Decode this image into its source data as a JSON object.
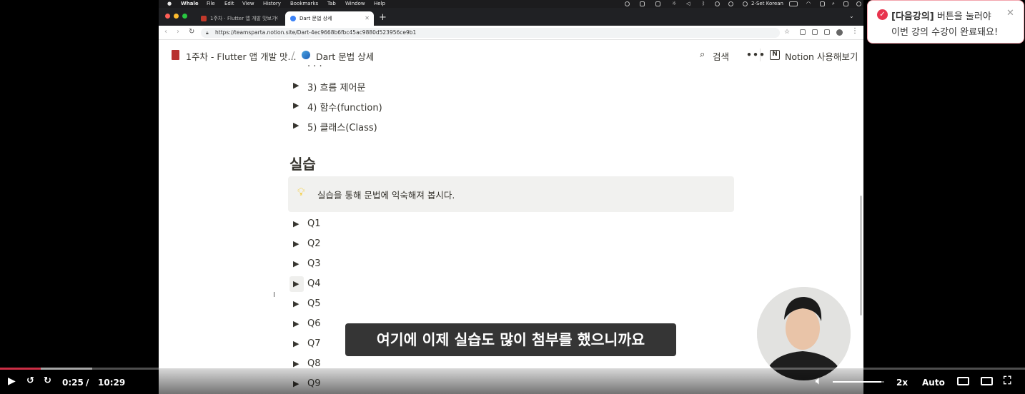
{
  "menubar": {
    "app": "Whale",
    "items": [
      "File",
      "Edit",
      "View",
      "History",
      "Bookmarks",
      "Tab",
      "Window",
      "Help"
    ],
    "input_source": "2-Set Korean"
  },
  "browser": {
    "tabs": [
      {
        "label": "1주차 · Flutter 앱 개발 맛보기",
        "active": false
      },
      {
        "label": "Dart 문법 상세",
        "active": true
      }
    ],
    "url": "https://teamsparta.notion.site/Dart-4ec9668b6fbc45ac9880d523956ce9b1"
  },
  "notion": {
    "breadcrumb": [
      "1주차 - Flutter 앱 개발 맛...",
      "Dart 문법 상세"
    ],
    "search_label": "검색",
    "notion_button": "Notion 사용해보기",
    "toggles_top": [
      "3) 흐름 제어문",
      "4) 함수(function)",
      "5) 클래스(Class)"
    ],
    "section_heading": "실습",
    "callout_icon": "lightbulb-icon",
    "callout_text": "실습을 통해 문법에 익숙해져 봅시다.",
    "toggles_q": [
      "Q1",
      "Q2",
      "Q3",
      "Q4",
      "Q5",
      "Q6",
      "Q7",
      "Q8",
      "Q9"
    ]
  },
  "toast": {
    "highlight": "[다음강의]",
    "line1_rest": " 버튼을 눌러야",
    "line2": "이번 강의 수강이 완료돼요!"
  },
  "player": {
    "subtitle": "여기에 이제 실습도 많이 첨부를 했으니까요",
    "current_time": "0:25",
    "separator": "/",
    "duration": "10:29",
    "progress": 0.04,
    "buffered": 0.09,
    "volume": 0.95,
    "speed": "2x",
    "quality": "Auto"
  },
  "colors": {
    "accent_red": "#e8344e",
    "notion_text": "#37352f",
    "callout_bg": "#f1f1ef"
  }
}
